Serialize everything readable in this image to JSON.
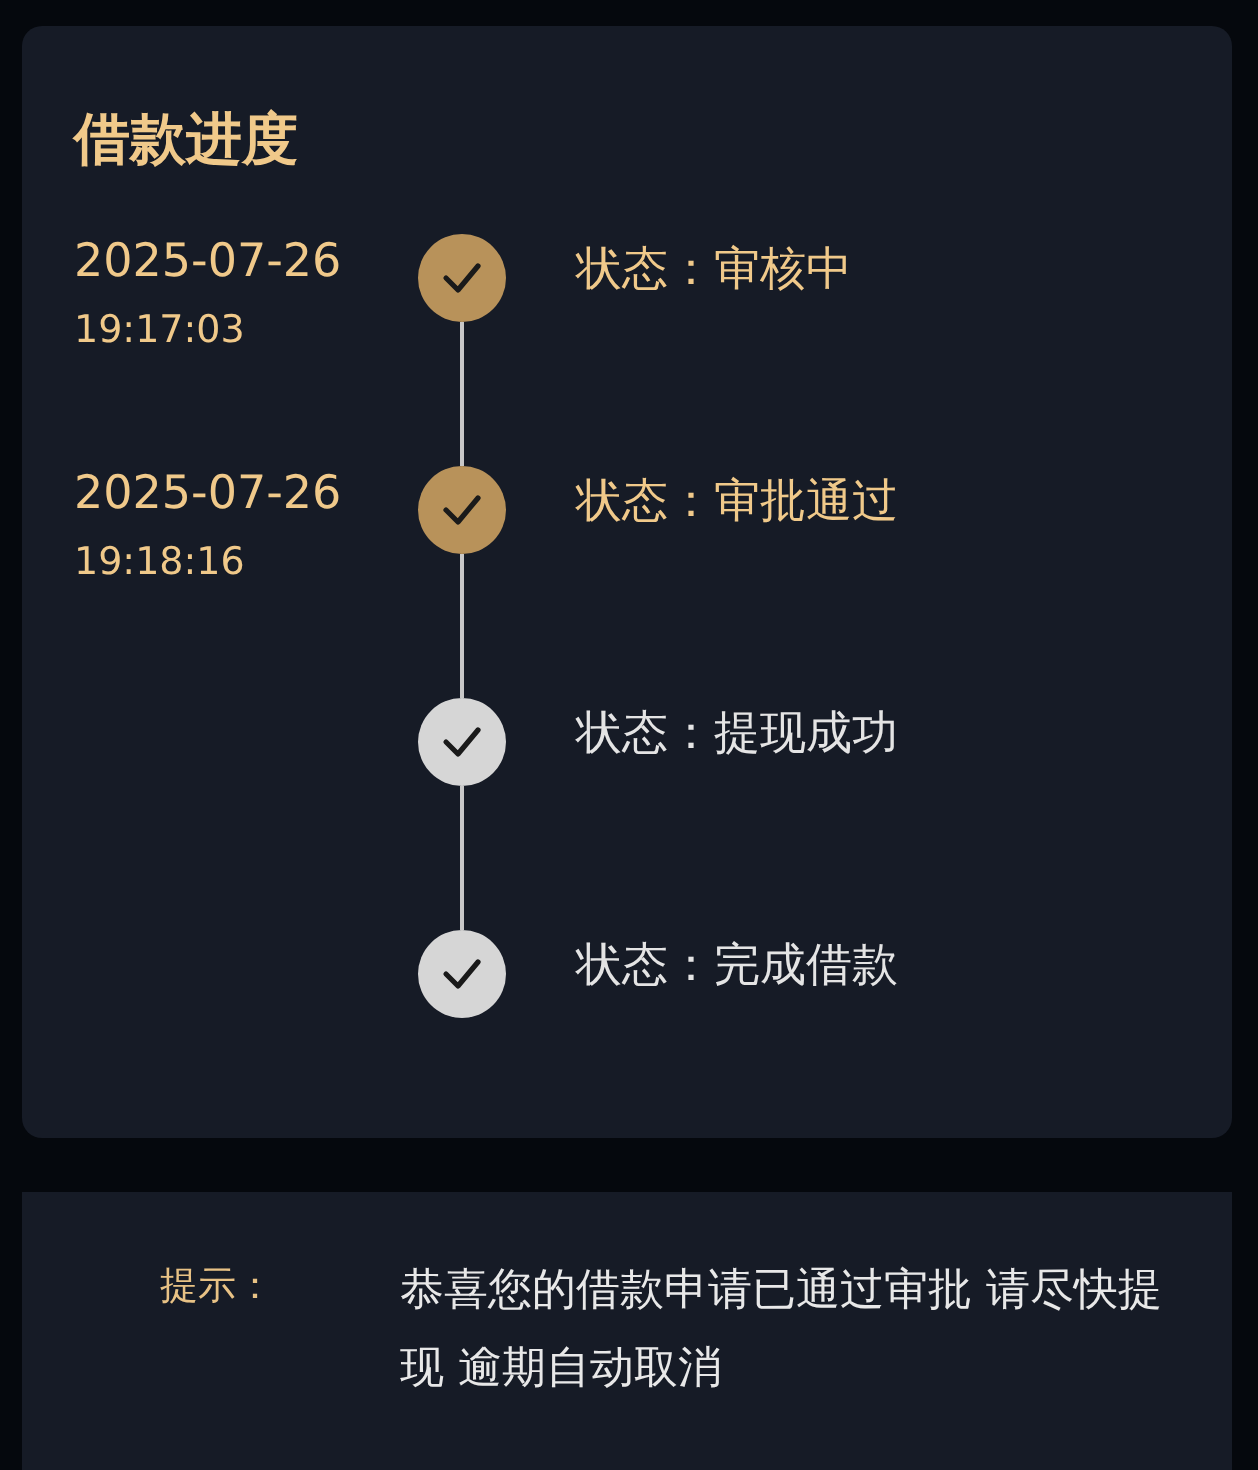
{
  "title": "借款进度",
  "steps": [
    {
      "date": "2025-07-26",
      "time": "19:17:03",
      "status": "状态：审核中",
      "done": true
    },
    {
      "date": "2025-07-26",
      "time": "19:18:16",
      "status": "状态：审批通过",
      "done": true
    },
    {
      "status": "状态：提现成功",
      "done": false
    },
    {
      "status": "状态：完成借款",
      "done": false
    }
  ],
  "notice": {
    "label": "提示：",
    "message": "恭喜您的借款申请已通过审批 请尽快提现 逾期自动取消"
  }
}
